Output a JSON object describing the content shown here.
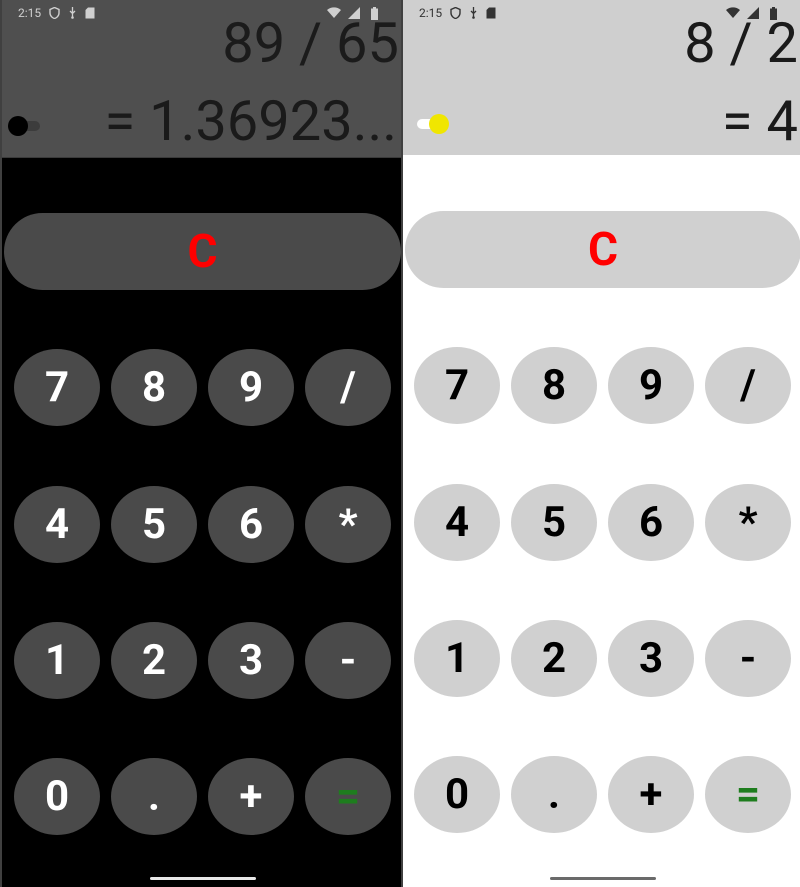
{
  "left_screen": {
    "status": {
      "time": "2:15"
    },
    "display": {
      "expression": "89 / 65",
      "result": "= 1.36923..."
    },
    "theme_toggle_on": false,
    "clear_label": "C",
    "keys": [
      [
        "7",
        "8",
        "9",
        "/"
      ],
      [
        "4",
        "5",
        "6",
        "*"
      ],
      [
        "1",
        "2",
        "3",
        "-"
      ],
      [
        "0",
        ".",
        "+",
        "="
      ]
    ]
  },
  "right_screen": {
    "status": {
      "time": "2:15"
    },
    "display": {
      "expression": "8 / 2",
      "result": "= 4"
    },
    "theme_toggle_on": true,
    "clear_label": "C",
    "keys": [
      [
        "7",
        "8",
        "9",
        "/"
      ],
      [
        "4",
        "5",
        "6",
        "*"
      ],
      [
        "1",
        "2",
        "3",
        "-"
      ],
      [
        "0",
        ".",
        "+",
        "="
      ]
    ]
  },
  "colors": {
    "clear_text": "#ff0000",
    "equals_text": "#1e7d1e",
    "toggle_on_thumb": "#f0e600",
    "dark_key_bg": "#4a4a4a",
    "light_key_bg": "#d0d0d0"
  }
}
